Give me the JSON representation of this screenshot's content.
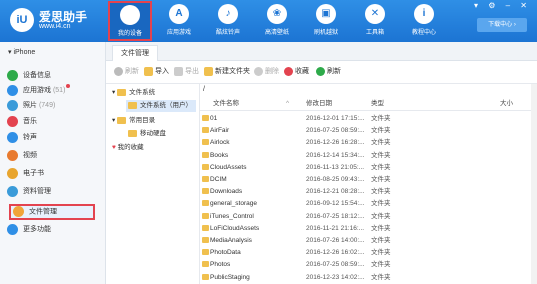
{
  "app": {
    "logo_text": "iU",
    "name": "爱思助手",
    "url": "www.i4.cn",
    "window_controls": "▾ ⚙ – ✕",
    "download_center": "下载中心 ›"
  },
  "nav": [
    {
      "label": "我的设备",
      "icon": "apple-icon",
      "glyph": "",
      "active": true
    },
    {
      "label": "应用游戏",
      "icon": "appstore-icon",
      "glyph": "A"
    },
    {
      "label": "酷炫铃声",
      "icon": "bell-icon",
      "glyph": "♪"
    },
    {
      "label": "高清壁纸",
      "icon": "wallpaper-icon",
      "glyph": "❀"
    },
    {
      "label": "刷机越狱",
      "icon": "box-icon",
      "glyph": "▣"
    },
    {
      "label": "工具箱",
      "icon": "tools-icon",
      "glyph": "✕"
    },
    {
      "label": "教程中心",
      "icon": "info-icon",
      "glyph": "i"
    }
  ],
  "sidebar": {
    "device": "▾ iPhone",
    "items": [
      {
        "label": "设备信息",
        "count": "",
        "icon": "info-icon",
        "color": "#2eaa4a"
      },
      {
        "label": "应用游戏",
        "count": "(51)",
        "icon": "appstore-icon",
        "color": "#2f8fe6"
      },
      {
        "label": "照片",
        "count": "(749)",
        "icon": "photo-icon",
        "color": "#3a9bd9"
      },
      {
        "label": "音乐",
        "count": "",
        "icon": "music-icon",
        "color": "#e3434f"
      },
      {
        "label": "铃声",
        "count": "",
        "icon": "bell-icon",
        "color": "#2f8fe6"
      },
      {
        "label": "视频",
        "count": "",
        "icon": "video-icon",
        "color": "#e87a2f"
      },
      {
        "label": "电子书",
        "count": "",
        "icon": "book-icon",
        "color": "#e8a52f"
      },
      {
        "label": "资料管理",
        "count": "",
        "icon": "data-icon",
        "color": "#3a9bd9"
      },
      {
        "label": "文件管理",
        "count": "",
        "icon": "folder-icon",
        "color": "#f0a43a",
        "active": true
      },
      {
        "label": "更多功能",
        "count": "",
        "icon": "more-icon",
        "color": "#2f8fe6"
      }
    ]
  },
  "tab": "文件管理",
  "toolbar": [
    {
      "label": "刷新",
      "icon": "refresh-icon",
      "color": "#bbb",
      "disabled": true
    },
    {
      "label": "导入",
      "icon": "import-icon",
      "color": "#f0c04e"
    },
    {
      "label": "导出",
      "icon": "export-icon",
      "color": "#ccc",
      "disabled": true
    },
    {
      "label": "新建文件夹",
      "icon": "new-folder-icon",
      "color": "#f0c04e"
    },
    {
      "label": "删除",
      "icon": "delete-icon",
      "color": "#ccc",
      "disabled": true
    },
    {
      "label": "收藏",
      "icon": "heart-icon",
      "color": "#e3434f"
    },
    {
      "label": "刷新",
      "icon": "refresh-icon",
      "color": "#2eaa4a"
    }
  ],
  "tree": [
    {
      "label": "文件系统",
      "arrow": "▾"
    },
    {
      "label": "文件系统（用户）",
      "selected": true
    },
    {
      "label": "常用目录",
      "arrow": "▾"
    },
    {
      "label": "移动硬盘"
    },
    {
      "label": "我的收藏",
      "heart": true
    }
  ],
  "list": {
    "path": "/",
    "headers": {
      "name": "文件名称",
      "date": "修改日期",
      "type": "类型",
      "size": "大小"
    },
    "rows": [
      {
        "name": "01",
        "date": "2016-12-01 17:15:...",
        "type": "文件夹"
      },
      {
        "name": "AirFair",
        "date": "2016-07-25 08:59:...",
        "type": "文件夹"
      },
      {
        "name": "Airlock",
        "date": "2016-12-26 16:28:...",
        "type": "文件夹"
      },
      {
        "name": "Books",
        "date": "2016-12-14 15:34:...",
        "type": "文件夹"
      },
      {
        "name": "CloudAssets",
        "date": "2016-11-13 21:05:...",
        "type": "文件夹"
      },
      {
        "name": "DCIM",
        "date": "2016-08-25 09:43:...",
        "type": "文件夹"
      },
      {
        "name": "Downloads",
        "date": "2016-12-21 08:28:...",
        "type": "文件夹"
      },
      {
        "name": "general_storage",
        "date": "2016-09-12 15:54:...",
        "type": "文件夹"
      },
      {
        "name": "iTunes_Control",
        "date": "2016-07-25 18:12:...",
        "type": "文件夹"
      },
      {
        "name": "LoFiCloudAssets",
        "date": "2016-11-21 21:16:...",
        "type": "文件夹"
      },
      {
        "name": "MediaAnalysis",
        "date": "2016-07-26 14:00:...",
        "type": "文件夹"
      },
      {
        "name": "PhotoData",
        "date": "2016-12-26 16:02:...",
        "type": "文件夹"
      },
      {
        "name": "Photos",
        "date": "2016-07-25 08:59:...",
        "type": "文件夹"
      },
      {
        "name": "PublicStaging",
        "date": "2016-12-23 14:02:...",
        "type": "文件夹"
      }
    ]
  }
}
